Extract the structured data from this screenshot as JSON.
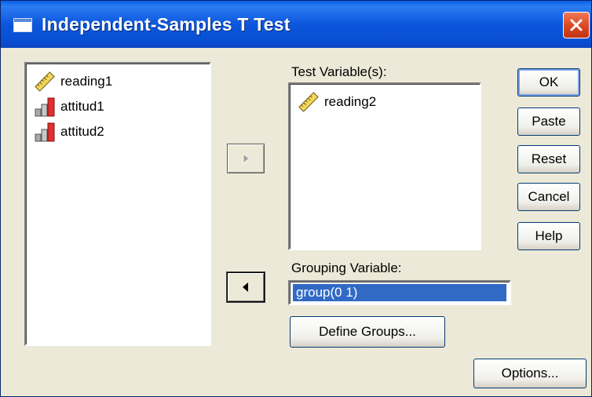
{
  "window": {
    "title": "Independent-Samples T Test",
    "close_icon": "close-icon",
    "title_icon": "dialog-window-icon"
  },
  "source_list": {
    "items": [
      {
        "label": "reading1",
        "icon": "scale-ruler-icon"
      },
      {
        "label": "attitud1",
        "icon": "ordinal-bars-icon"
      },
      {
        "label": "attitud2",
        "icon": "ordinal-bars-icon"
      }
    ]
  },
  "test_variables": {
    "caption": "Test Variable(s):",
    "items": [
      {
        "label": "reading2",
        "icon": "scale-ruler-icon"
      }
    ]
  },
  "grouping": {
    "caption": "Grouping Variable:",
    "value": "group(0 1)"
  },
  "buttons": {
    "ok": "OK",
    "paste": "Paste",
    "reset": "Reset",
    "cancel": "Cancel",
    "help": "Help",
    "define_groups": "Define Groups...",
    "options": "Options..."
  },
  "arrows": {
    "move_right": "right-arrow-icon",
    "move_right_enabled": false,
    "move_left": "left-arrow-icon",
    "move_left_enabled": true
  },
  "colors": {
    "title_bar": "#0a4fd3",
    "dialog_bg": "#ece9d8",
    "selection": "#316ac5",
    "close_button": "#d8471f"
  }
}
